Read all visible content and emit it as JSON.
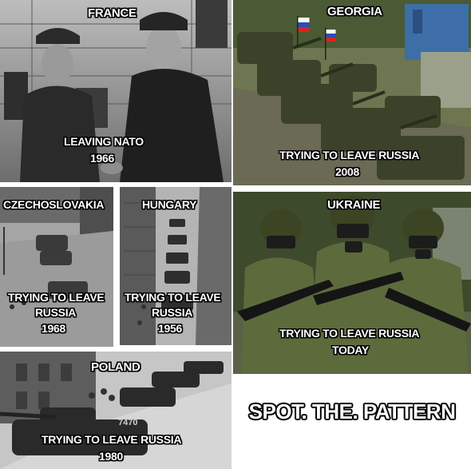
{
  "panels": {
    "france": {
      "country": "FRANCE",
      "line1": "LEAVING NATO",
      "year": "1966"
    },
    "georgia": {
      "country": "GEORGIA",
      "line1": "TRYING TO LEAVE RUSSIA",
      "year": "2008"
    },
    "czechoslovakia": {
      "country": "CZECHOSLOVAKIA",
      "line1": "TRYING TO LEAVE",
      "line2": "RUSSIA",
      "year": "1968"
    },
    "hungary": {
      "country": "HUNGARY",
      "line1": "TRYING TO LEAVE",
      "line2": "RUSSIA",
      "year": "1956"
    },
    "ukraine": {
      "country": "UKRAINE",
      "line1": "TRYING TO LEAVE RUSSIA",
      "year": "TODAY"
    },
    "poland": {
      "country": "POLAND",
      "line1": "TRYING TO LEAVE RUSSIA",
      "year": "1980",
      "tank_number": "7470"
    }
  },
  "tagline": "SPOT. THE. PATTERN",
  "colors": {
    "caption_fill": "#ffffff",
    "caption_outline": "#000000",
    "background": "#ffffff"
  }
}
